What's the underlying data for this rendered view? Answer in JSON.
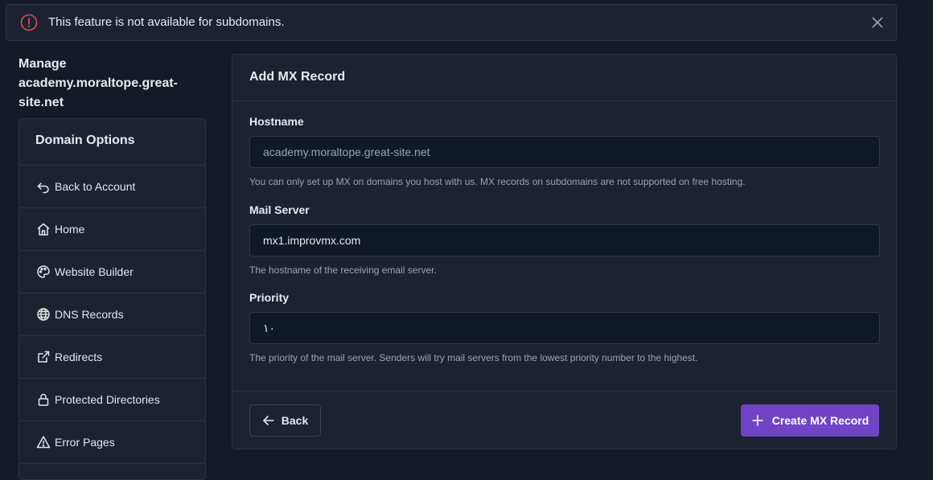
{
  "alert": {
    "message": "This feature is not available for subdomains.",
    "icon": "exclamation-circle-icon",
    "color": "#e04b52"
  },
  "manage": {
    "title": "Manage academy.moraltope.great-site.net"
  },
  "sidebar": {
    "header": "Domain Options",
    "items": [
      {
        "label": "Back to Account",
        "icon": "back-arrow-icon"
      },
      {
        "label": "Home",
        "icon": "home-icon"
      },
      {
        "label": "Website Builder",
        "icon": "palette-icon"
      },
      {
        "label": "DNS Records",
        "icon": "globe-icon"
      },
      {
        "label": "Redirects",
        "icon": "external-link-icon"
      },
      {
        "label": "Protected Directories",
        "icon": "lock-icon"
      },
      {
        "label": "Error Pages",
        "icon": "warning-icon"
      }
    ]
  },
  "form": {
    "title": "Add MX Record",
    "hostname": {
      "label": "Hostname",
      "value": "academy.moraltope.great-site.net",
      "help": "You can only set up MX on domains you host with us. MX records on subdomains are not supported on free hosting."
    },
    "mail_server": {
      "label": "Mail Server",
      "value": "mx1.improvmx.com",
      "help": "The hostname of the receiving email server."
    },
    "priority": {
      "label": "Priority",
      "value": "١٠",
      "help": "The priority of the mail server. Senders will try mail servers from the lowest priority number to the highest."
    },
    "back_label": "Back",
    "create_label": "Create MX Record",
    "accent": "#7044c4"
  }
}
